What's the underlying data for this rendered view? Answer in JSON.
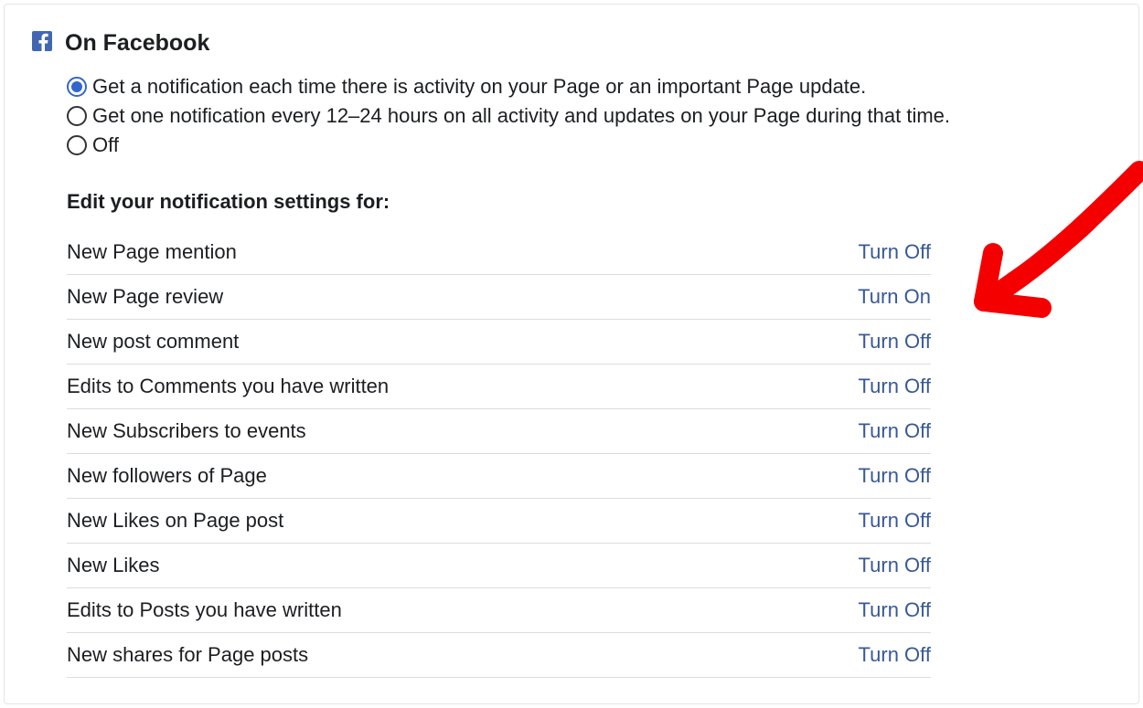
{
  "header": {
    "title": "On Facebook"
  },
  "radio_options": [
    {
      "label": "Get a notification each time there is activity on your Page or an important Page update.",
      "selected": true
    },
    {
      "label": "Get one notification every 12–24 hours on all activity and updates on your Page during that time.",
      "selected": false
    },
    {
      "label": "Off",
      "selected": false
    }
  ],
  "subtitle": "Edit your notification settings for:",
  "settings": [
    {
      "label": "New Page mention",
      "action": "Turn Off"
    },
    {
      "label": "New Page review",
      "action": "Turn On"
    },
    {
      "label": "New post comment",
      "action": "Turn Off"
    },
    {
      "label": "Edits to Comments you have written",
      "action": "Turn Off"
    },
    {
      "label": "New Subscribers to events",
      "action": "Turn Off"
    },
    {
      "label": "New followers of Page",
      "action": "Turn Off"
    },
    {
      "label": "New Likes on Page post",
      "action": "Turn Off"
    },
    {
      "label": "New Likes",
      "action": "Turn Off"
    },
    {
      "label": "Edits to Posts you have written",
      "action": "Turn Off"
    },
    {
      "label": "New shares for Page posts",
      "action": "Turn Off"
    }
  ],
  "annotation": {
    "arrow_color": "#f40000"
  }
}
